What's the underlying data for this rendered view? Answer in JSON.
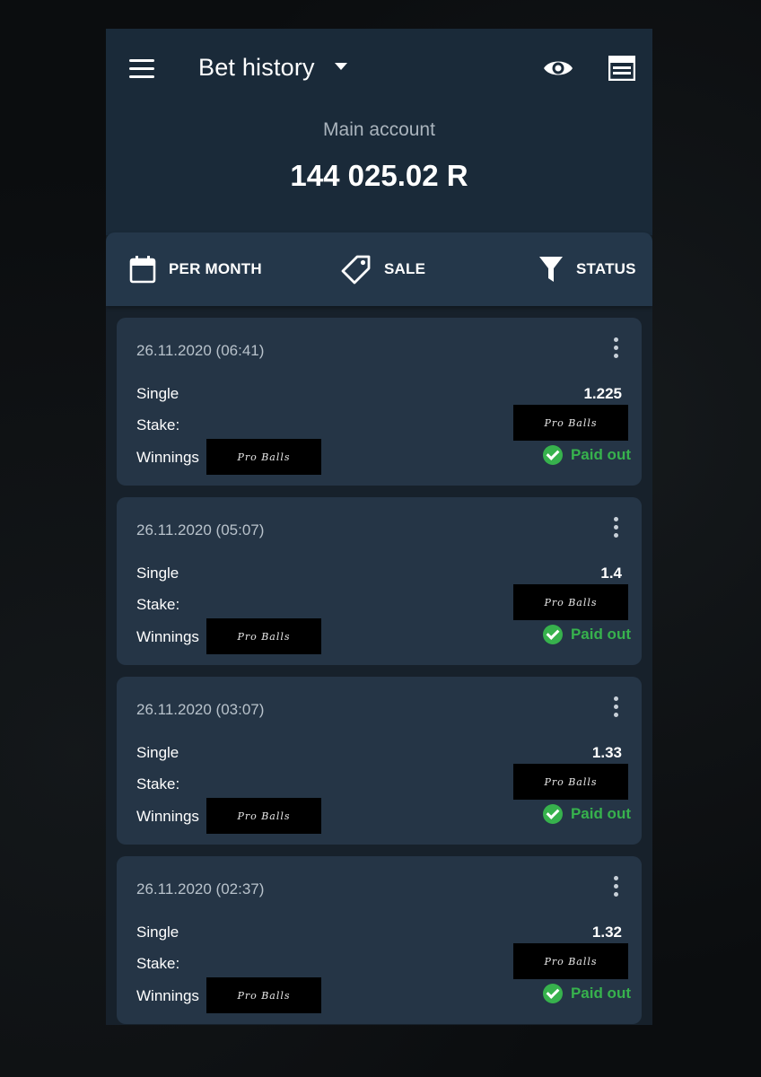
{
  "header": {
    "title": "Bet history",
    "account_label": "Main account",
    "balance": "144 025.02 R"
  },
  "filters": [
    {
      "label": "PER MONTH",
      "icon": "calendar-icon"
    },
    {
      "label": "SALE",
      "icon": "tag-icon"
    },
    {
      "label": "STATUS",
      "icon": "filter-icon"
    }
  ],
  "labels": {
    "stake": "Stake:",
    "winnings": "Winnings"
  },
  "bets": [
    {
      "datetime": "26.11.2020 (06:41)",
      "type": "Single",
      "odds": "1.225",
      "status": "Paid out"
    },
    {
      "datetime": "26.11.2020 (05:07)",
      "type": "Single",
      "odds": "1.4",
      "status": "Paid out"
    },
    {
      "datetime": "26.11.2020 (03:07)",
      "type": "Single",
      "odds": "1.33",
      "status": "Paid out"
    },
    {
      "datetime": "26.11.2020 (02:37)",
      "type": "Single",
      "odds": "1.32",
      "status": "Paid out"
    }
  ],
  "colors": {
    "header_bg": "#1a2a39",
    "card_bg": "#253546",
    "filterbar_bg": "#24374a",
    "status_green": "#37b24d"
  }
}
